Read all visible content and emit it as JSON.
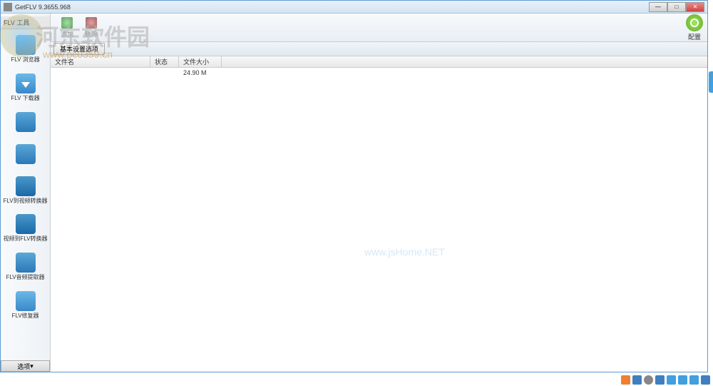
{
  "window": {
    "title": "GetFLV 9.3655.968"
  },
  "sidebar": {
    "header": "FLV 工具",
    "items": [
      {
        "label": "FLV 浏览器"
      },
      {
        "label": "FLV 下载器"
      },
      {
        "label": ""
      },
      {
        "label": ""
      },
      {
        "label": "FLV到视频转换器"
      },
      {
        "label": "视频到FLV转换器"
      },
      {
        "label": "FLV音频提取器"
      },
      {
        "label": "FLV修复器"
      }
    ],
    "options_label": "选项"
  },
  "toolbar": {
    "add_label": "添加",
    "del_label": "删除",
    "config_label": "配置"
  },
  "subbar": {
    "button_label": "基本设置选项"
  },
  "columns": {
    "name": "文件名",
    "status": "状态",
    "size": "文件大小"
  },
  "rows": [
    {
      "name": "",
      "status": "",
      "size": "24.90 M"
    }
  ],
  "watermark": {
    "text": "河东软件园",
    "url": "www.pc0359.cn",
    "center": "www.jsHome.NET"
  }
}
